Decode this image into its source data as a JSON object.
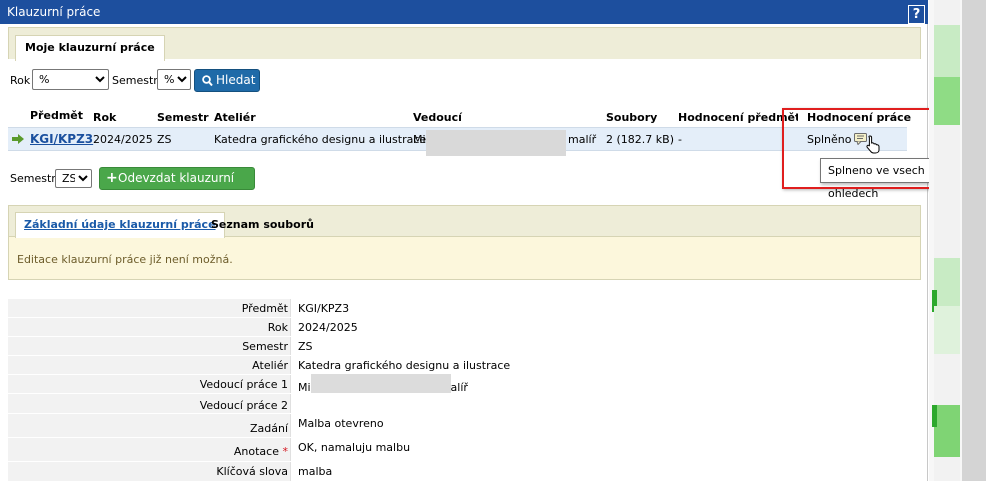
{
  "window": {
    "title": "Klauzurní práce",
    "help": "?"
  },
  "tabs": {
    "main": "Moje klauzurní práce"
  },
  "filters": {
    "rok_label": "Rok",
    "rok_value": "%",
    "semestr_label": "Semestr",
    "semestr_value": "%",
    "search_button": "Hledat"
  },
  "table": {
    "headers": [
      "Předmět",
      "Rok",
      "Semestr",
      "Ateliér",
      "Vedoucí",
      "Soubory",
      "Hodnocení předmětu",
      "Hodnocení práce"
    ],
    "row": {
      "predmet": "KGI/KPZ3",
      "rok": "2024/2025",
      "semestr": "ZS",
      "atelier": "Katedra grafického designu a ilustrace",
      "vedouci_prefix": "Mi",
      "vedouci_suffix": "malíř",
      "soubory": "2 (182.7 kB)",
      "hodnoceni_predmetu": "-",
      "hodnoceni_prace": "Splněno"
    },
    "tooltip": "Splneno ve vsech ohledech"
  },
  "submit": {
    "semestr_label": "Semestr:",
    "semestr_value": "ZS",
    "button": "Odevzdat klauzurní práci"
  },
  "detail_tabs": {
    "basic": "Základní údaje klauzurní práce",
    "files": "Seznam souborů"
  },
  "notice": "Editace klauzurní práce již není možná.",
  "form": {
    "predmet_label": "Předmět",
    "predmet_value": "KGI/KPZ3",
    "rok_label": "Rok",
    "rok_value": "2024/2025",
    "semestr_label": "Semestr",
    "semestr_value": "ZS",
    "atelier_label": "Ateliér",
    "atelier_value": "Katedra grafického designu a ilustrace",
    "vedouci1_label": "Vedoucí práce 1",
    "vedouci1_prefix": "Mi",
    "vedouci1_suffix": "alíř",
    "vedouci2_label": "Vedoucí práce 2",
    "zadani_label": "Zadání",
    "zadani_value": "Malba otevreno",
    "anotace_label": "Anotace",
    "anotace_required": "*",
    "anotace_value": "OK, namaluju malbu",
    "klicova_label": "Klíčová slova",
    "klicova_value": "malba"
  },
  "colors": {
    "titlebar": "#1d4f9e",
    "highlight": "#e01e1e",
    "row": "#e4eef9",
    "tab_bar": "#eeedd8",
    "notice_bg": "#fcf7dc",
    "green_button": "#4aa74a",
    "blue_button": "#1f6aa8"
  },
  "icons": [
    "help-icon",
    "search-icon",
    "row-arrow-icon",
    "rating-comment-icon",
    "mouse-cursor-icon",
    "plus-icon"
  ]
}
